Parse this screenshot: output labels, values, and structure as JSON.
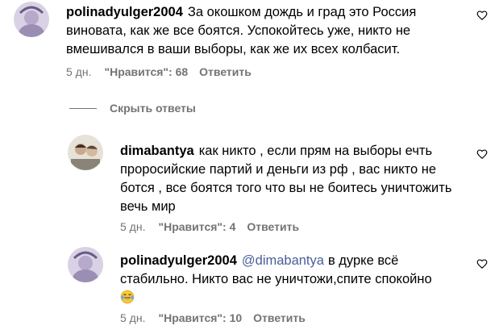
{
  "comments": [
    {
      "username": "polinadyulger2004",
      "mention": "",
      "text": "За окошком дождь и град это Россия виновата, как же все боятся. Успокойтесь уже, никто не вмешивался в ваши выборы, как же их всех колбасит.",
      "time": "5 дн.",
      "likes": "\"Нравится\": 68",
      "reply": "Ответить"
    },
    {
      "username": "dimabantya",
      "mention": "",
      "text": "как никто , если прям на выборы ечть проросийские партий и деньги из рф , вас никто не ботся , все боятся того что вы не боитесь уничтожить вечь мир",
      "time": "5 дн.",
      "likes": "\"Нравится\": 4",
      "reply": "Ответить"
    },
    {
      "username": "polinadyulger2004",
      "mention": "@dimabantya",
      "text": "в дурке всё стабильно. Никто вас не уничтожи,спите спокойно",
      "emoji": "laughing-with-tears-emoji",
      "time": "5 дн.",
      "likes": "\"Нравится\": 10",
      "reply": "Ответить"
    }
  ],
  "hide_replies_label": "Скрыть ответы",
  "icons": {
    "like": "heart-outline-icon",
    "avatar": "profile-avatar"
  },
  "colors": {
    "meta_text": "#737373",
    "mention": "#4a5d9a",
    "text": "#000000",
    "background": "#ffffff"
  }
}
